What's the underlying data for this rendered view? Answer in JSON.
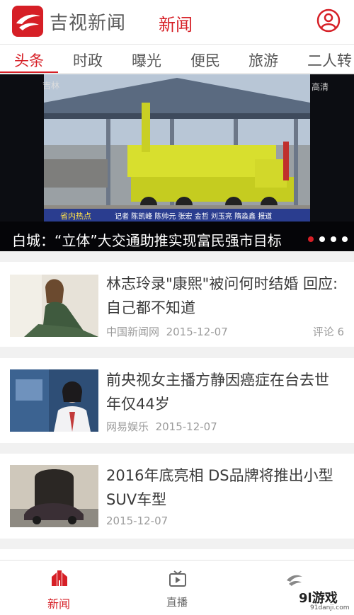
{
  "header": {
    "app_name": "吉视新闻",
    "title": "新闻",
    "accent_color": "#d61f26",
    "user_icon": "user-icon"
  },
  "tabs": [
    {
      "label": "头条",
      "active": true
    },
    {
      "label": "时政",
      "active": false
    },
    {
      "label": "曝光",
      "active": false
    },
    {
      "label": "便民",
      "active": false
    },
    {
      "label": "旅游",
      "active": false
    },
    {
      "label": "二人转",
      "active": false
    }
  ],
  "banner": {
    "caption": "白城：“立体”大交通助推实现富民强市目标",
    "dot_count": 4,
    "active_dot": 1,
    "video_text": {
      "station": "吉林",
      "hd": "高清",
      "section": "省内热点",
      "reporters": "记者 陈凯峰 陈帅元 张宏 金哲 刘玉亮 隋淼鑫 报道"
    }
  },
  "news": [
    {
      "title": "林志玲录\"康熙\"被问何时结婚 回应:自己都不知道",
      "source": "中国新闻网",
      "date": "2015-12-07",
      "comment": "评论 6"
    },
    {
      "title": "前央视女主播方静因癌症在台去世 年仅44岁",
      "source": "网易娱乐",
      "date": "2015-12-07"
    },
    {
      "title": "2016年底亮相 DS品牌将推出小型SUV车型",
      "source": "",
      "date": "2015-12-07"
    }
  ],
  "bottom_nav": [
    {
      "label": "新闻",
      "icon": "news-icon",
      "active": true
    },
    {
      "label": "直播",
      "icon": "live-tv-icon",
      "active": false
    },
    {
      "label": "",
      "icon": "logo-icon",
      "active": false
    }
  ],
  "watermark": {
    "brand": "9l游戏",
    "site": "91danji.com"
  }
}
